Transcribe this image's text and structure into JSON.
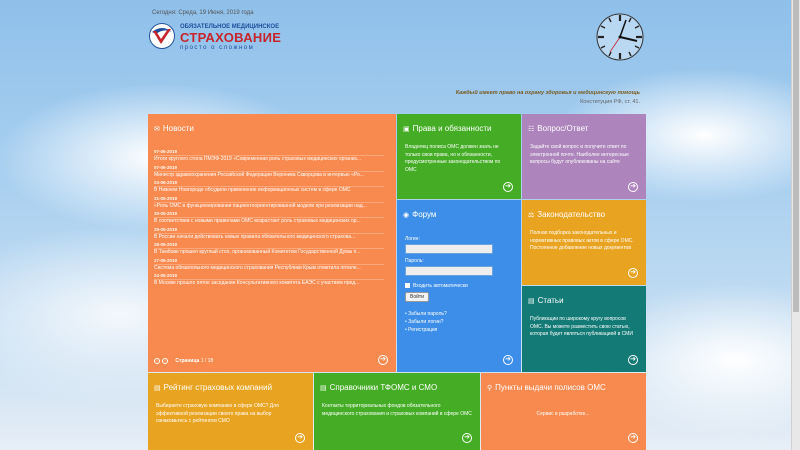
{
  "header": {
    "date": "Сегодня: Среда, 19 Июня, 2019 года",
    "logo_line1": "ОБЯЗАТЕЛЬНОЕ МЕДИЦИНСКОЕ",
    "logo_line2": "СТРАХОВАНИЕ",
    "logo_line3": "просто о сложном",
    "motto": "Каждый имеет право на охрану здоровья и медицинскую помощь",
    "motto_cite": "Конституция РФ, ст. 41."
  },
  "news": {
    "title": "Новости",
    "items": [
      {
        "date": "07-06-2019",
        "text": "Итоги круглого стола ПМЭФ-2019 «Современная роль страховых медицинских организ..."
      },
      {
        "date": "07-06-2019",
        "text": "Министр здравоохранения Российской Федерации Вероника Скворцова в интервью «Ро..."
      },
      {
        "date": "03-06-2019",
        "text": "В Нижнем Новгороде обсудили применение информационных систем в сфере ОМС"
      },
      {
        "date": "31-05-2019",
        "text": "«Роль ОМС в функционировании пациентоориентированной модели при реализации над..."
      },
      {
        "date": "30-05-2019",
        "text": "В соответствии с новыми правилами ОМС возрастает роль страховых медицинских ор..."
      },
      {
        "date": "29-05-2019",
        "text": "В России начали действовать новые правила обязательного медицинского страхова..."
      },
      {
        "date": "28-05-2019",
        "text": "В Тамбове прошел круглый стол, организованный Комитетом Государственной Думы п..."
      },
      {
        "date": "27-05-2019",
        "text": "Система обязательного медицинского страхования Республики Крым отметила пятиле..."
      },
      {
        "date": "24-05-2019",
        "text": "В Москве прошло пятое заседание Консультативного комитета ЕАЭС с участием пред..."
      }
    ],
    "page_label": "Страница",
    "page_value": "1 / 18"
  },
  "rights": {
    "title": "Права и обязанности",
    "text": "Владелец полиса ОМС должен знать не только свои права, но и обязанности, предусмотренные законодательством по ОМС"
  },
  "qa": {
    "title": "Вопрос/Ответ",
    "text": "Задайте свой вопрос и получите ответ по электронной почте. Наиболее интересные вопросы будут опубликованы на сайте"
  },
  "forum": {
    "title": "Форум",
    "login_label": "Логин:",
    "password_label": "Пароль:",
    "remember_label": "Входить автоматически",
    "submit_label": "Войти",
    "links": [
      "Забыли пароль?",
      "Забыли логин?",
      "Регистрация"
    ]
  },
  "law": {
    "title": "Законодательство",
    "text": "Полная подборка законодательных и нормативных правовых актов в сфере ОМС. Постоянное добавление новых документов"
  },
  "articles": {
    "title": "Статьи",
    "text": "Публикации по широкому кругу вопросов ОМС. Вы можете разместить свою статью, которая будет являться публикацией в СМИ"
  },
  "rating": {
    "title": "Рейтинг страховых компаний",
    "text": "Выбираете страховую компанию в сфере ОМС? Для эффективной реализации своего права на выбор ознакомьтесь с рейтингом СМО"
  },
  "directories": {
    "title": "Справочники ТФОМС и СМО",
    "text": "Контакты территориальных фондов обязательного медицинского страхования и страховых компаний в сфере ОМС"
  },
  "points": {
    "title": "Пункты выдачи полисов ОМС",
    "text": "Сервис в разработке..."
  },
  "colors": {
    "orange": "#f98a4f",
    "green": "#45ad25",
    "purple": "#ad84bb",
    "blue": "#3d8ee8",
    "amber": "#e8a320",
    "teal": "#137a76"
  }
}
